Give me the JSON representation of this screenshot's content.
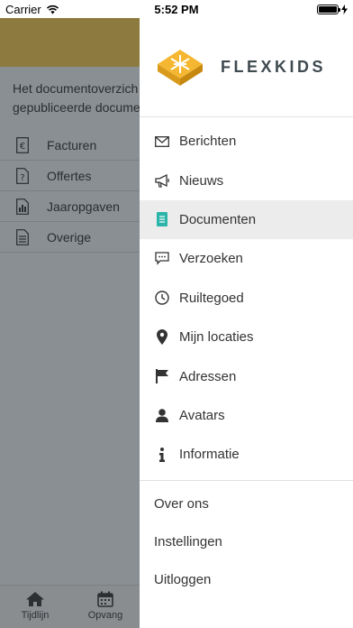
{
  "status_bar": {
    "carrier": "Carrier",
    "time": "5:52 PM"
  },
  "background": {
    "intro_text": "Het documentoverzicht gepubliceerde documen",
    "intro_line1": "Het documentoverzich",
    "intro_line2": "gepubliceerde documen",
    "rows": [
      {
        "label": "Facturen",
        "icon": "euro-doc-icon"
      },
      {
        "label": "Offertes",
        "icon": "question-doc-icon"
      },
      {
        "label": "Jaaropgaven",
        "icon": "bar-chart-doc-icon"
      },
      {
        "label": "Overige",
        "icon": "text-doc-icon"
      }
    ],
    "tabs": [
      {
        "label": "Tijdlijn",
        "icon": "home-icon"
      },
      {
        "label": "Opvang",
        "icon": "calendar-icon"
      }
    ],
    "header_color": "#8d7a3f"
  },
  "drawer": {
    "brand": "FLEXKIDS",
    "brand_color": "#f5b731",
    "menu": [
      {
        "label": "Berichten",
        "icon": "envelope-icon"
      },
      {
        "label": "Nieuws",
        "icon": "megaphone-icon"
      },
      {
        "label": "Documenten",
        "icon": "document-icon",
        "active": true
      },
      {
        "label": "Verzoeken",
        "icon": "chat-icon"
      },
      {
        "label": "Ruiltegoed",
        "icon": "clock-icon"
      },
      {
        "label": "Mijn locaties",
        "icon": "map-pin-icon"
      },
      {
        "label": "Adressen",
        "icon": "flag-icon"
      },
      {
        "label": "Avatars",
        "icon": "user-icon"
      },
      {
        "label": "Informatie",
        "icon": "info-icon"
      }
    ],
    "footer": [
      {
        "label": "Over ons"
      },
      {
        "label": "Instellingen"
      },
      {
        "label": "Uitloggen"
      }
    ],
    "active_color": "#2bb5a8"
  }
}
